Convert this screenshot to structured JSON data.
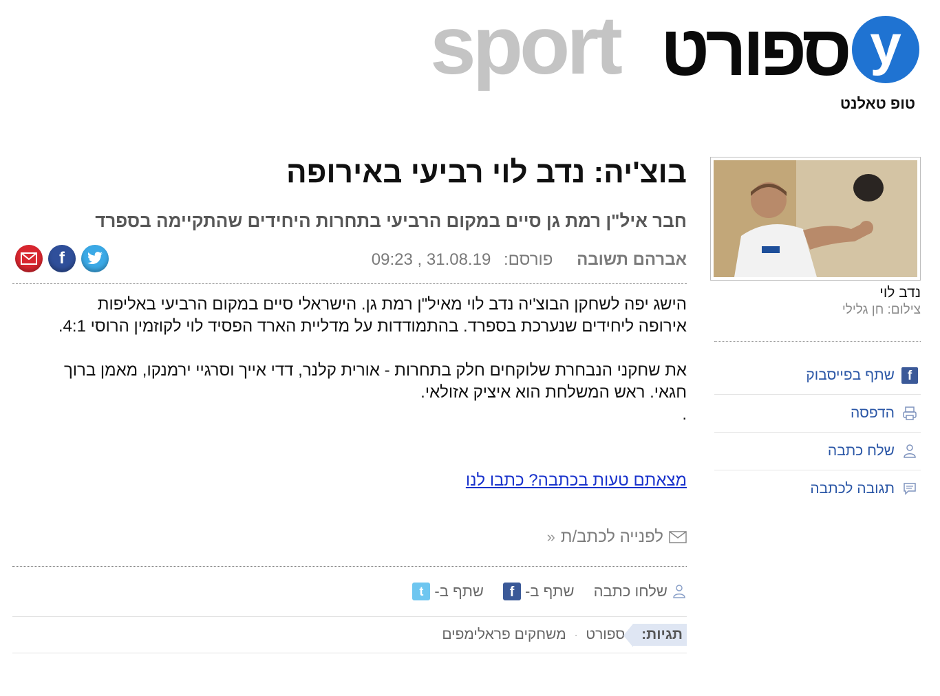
{
  "logo": {
    "badge_letter": "y",
    "hebrew_wordmark": "ספורט",
    "latin_wordmark": "sport",
    "brand_color": "#1f73d2"
  },
  "section": {
    "title": "טופ טאלנט"
  },
  "article": {
    "headline": "בוצ'יה: נדב לוי רביעי באירופה",
    "subheadline": "חבר איל\"ן רמת גן סיים במקום הרביעי בתחרות היחידים שהתקיימה בספרד",
    "author": "אברהם תשובה",
    "published_label": "פורסם:",
    "date": "31.08.19 , 09:23",
    "paragraphs": [
      "הישג יפה לשחקן הבוצ'יה נדב לוי מאיל\"ן רמת גן. הישראלי סיים במקום הרביעי באליפות אירופה ליחידים שנערכת בספרד. בהתמודדות על מדליית הארד הפסיד לוי לקוזמין הרוסי 4:1.",
      "את שחקני הנבחרת שלוקחים חלק בתחרות - אורית קלנר, דדי אייך וסרגיי ירמנקו, מאמן ברוך חגאי. ראש המשלחת הוא איציק אזולאי."
    ],
    "trailing_dot": ".",
    "error_link": "מצאתם טעות בכתבה? כתבו לנו",
    "contact_writer": "לפנייה לכתב/ת",
    "share": {
      "send_article": "שלחו כתבה",
      "share_facebook": "שתף ב-",
      "share_twitter": "שתף ב-"
    },
    "tags_label": "תגיות:",
    "tags": [
      "ספורט",
      "משחקים פראלימפים"
    ],
    "social_icons": [
      "twitter-icon",
      "facebook-icon",
      "mail-icon"
    ]
  },
  "sidebar": {
    "photo_caption": "נדב לוי",
    "photo_credit": "צילום: חן גלילי",
    "menu": [
      {
        "label": "שתף בפייסבוק",
        "icon": "facebook-icon"
      },
      {
        "label": "הדפסה",
        "icon": "print-icon"
      },
      {
        "label": "שלח כתבה",
        "icon": "person-icon"
      },
      {
        "label": "תגובה לכתבה",
        "icon": "comment-icon"
      }
    ]
  }
}
